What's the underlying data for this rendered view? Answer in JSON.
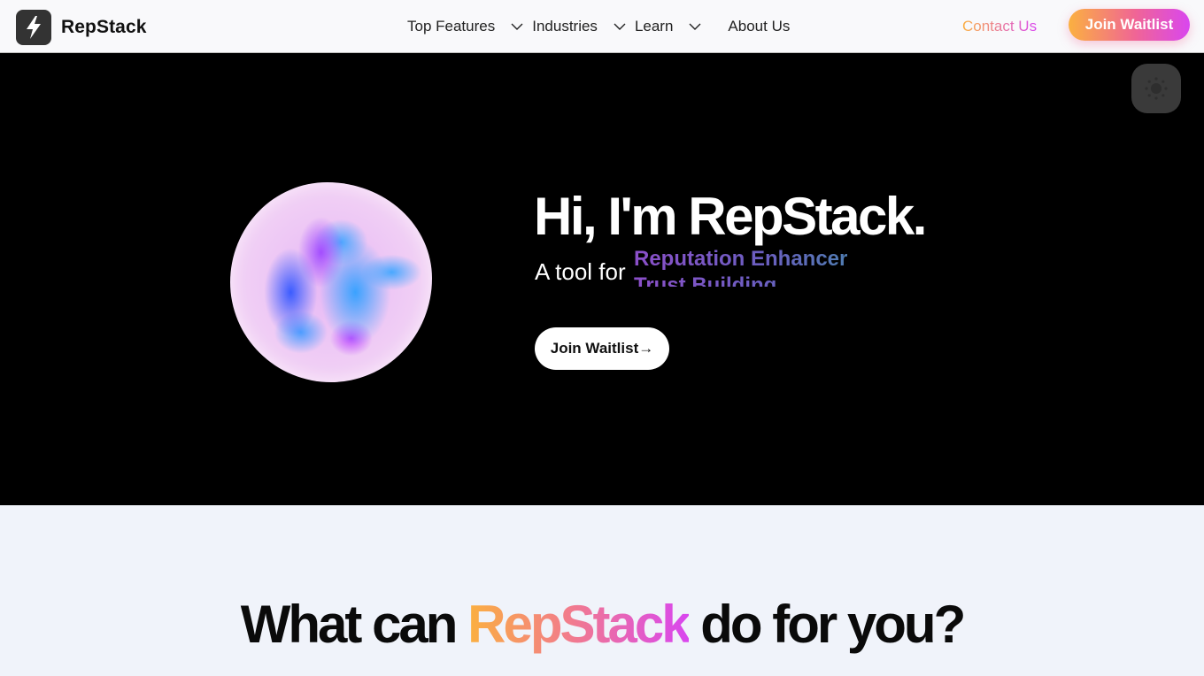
{
  "header": {
    "brand": "RepStack",
    "logo_icon": "lightning-bolt-icon",
    "nav": [
      {
        "label": "Top Features",
        "has_dropdown": true
      },
      {
        "label": "Industries",
        "has_dropdown": true
      },
      {
        "label": "Learn",
        "has_dropdown": true
      },
      {
        "label": "About Us",
        "has_dropdown": false
      }
    ],
    "contact_label": "Contact Us",
    "join_label": "Join Waitlist"
  },
  "hero": {
    "title": "Hi, I'm RepStack.",
    "subtitle_prefix": "A tool for",
    "rotating_words": [
      "Reputation Enhancer",
      "Trust Building"
    ],
    "cta_label": "Join Waitlist→",
    "theme_toggle_icon": "sun-icon"
  },
  "section2": {
    "title_before": "What can",
    "title_brand": "RepStack",
    "title_after": "do for you?"
  },
  "colors": {
    "gradient_start": "#fbb040",
    "gradient_mid": "#f06595",
    "gradient_end": "#d946ef",
    "hero_bg": "#000000",
    "section_bg": "#f0f3fa"
  }
}
